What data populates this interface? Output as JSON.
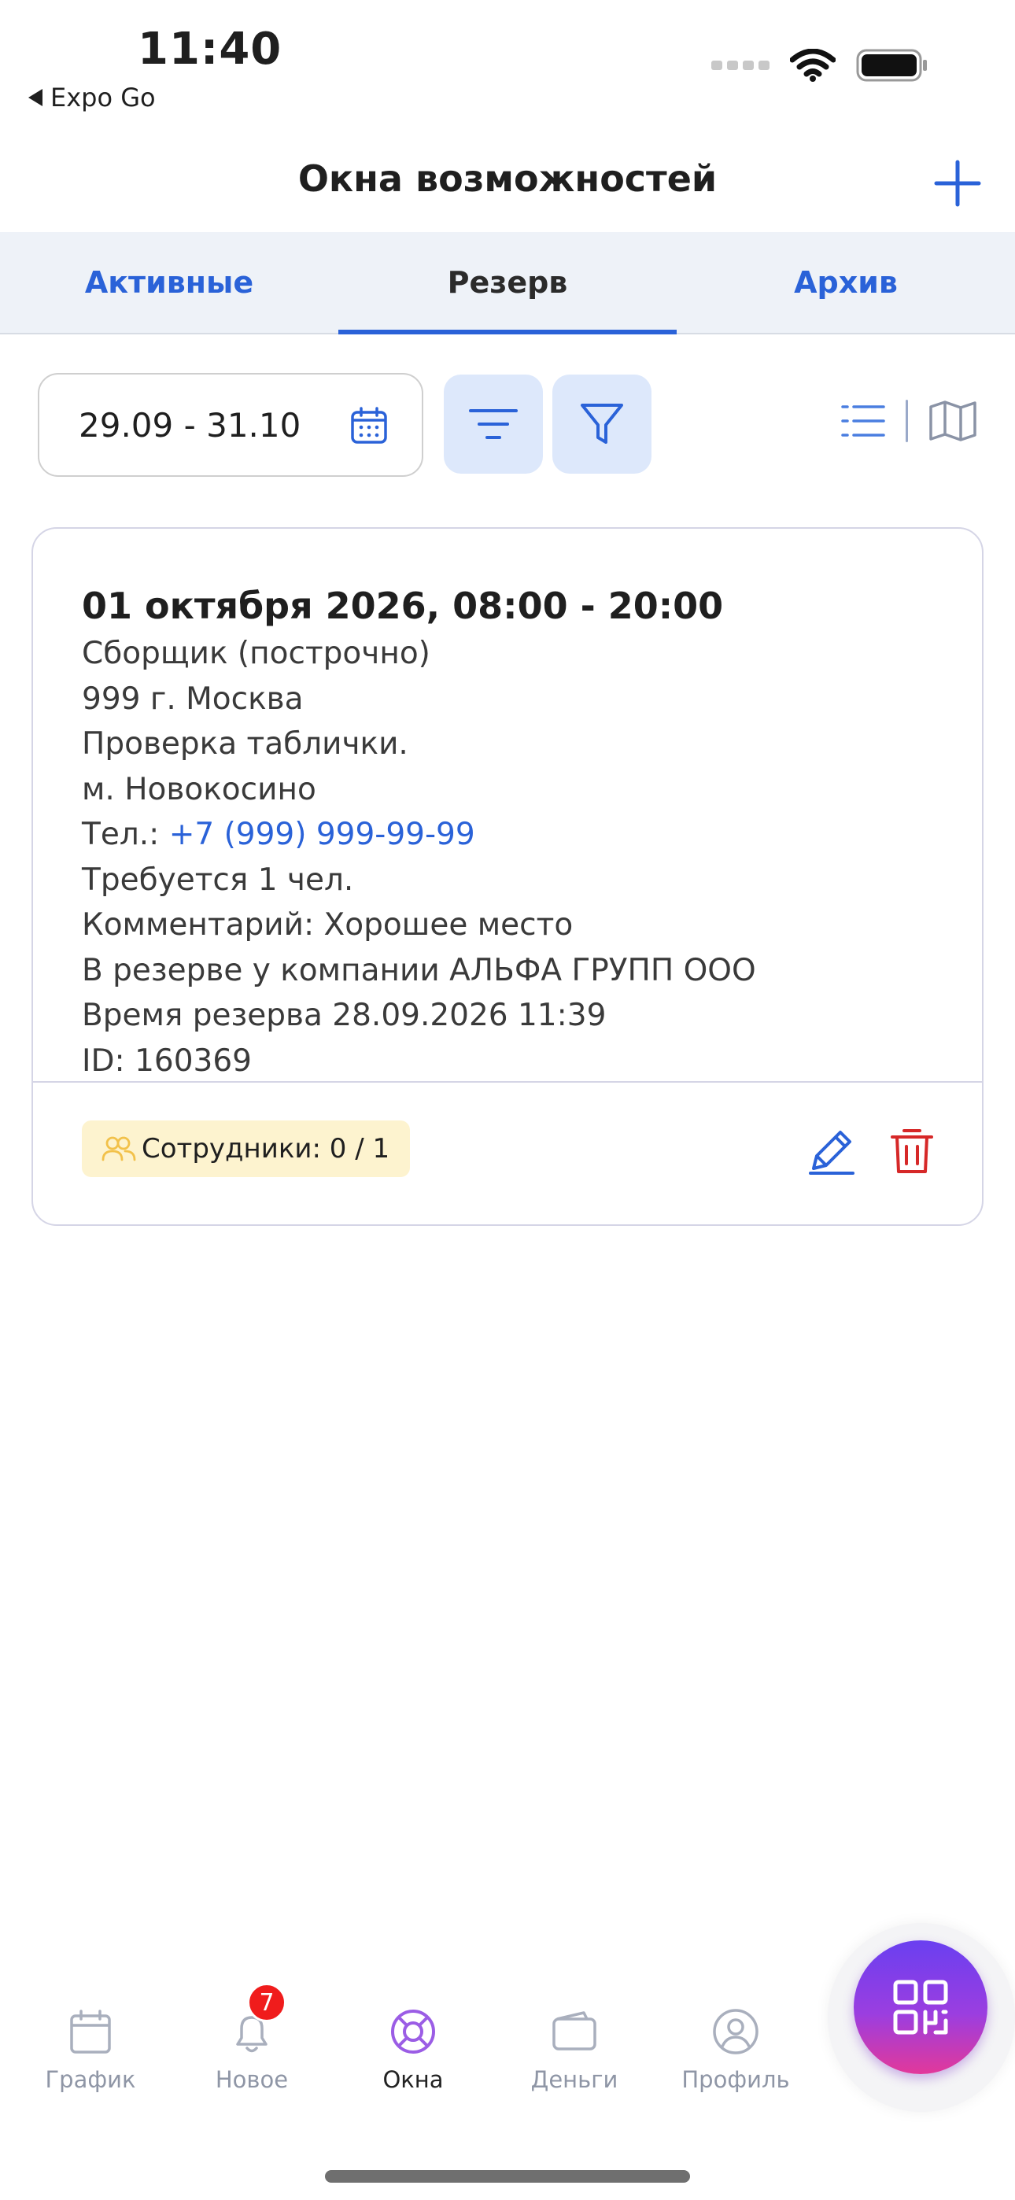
{
  "status_bar": {
    "time": "11:40",
    "back_app": "Expo Go"
  },
  "header": {
    "title": "Окна возможностей",
    "add_icon": "plus-icon"
  },
  "tabs": [
    {
      "label": "Активные",
      "active": false
    },
    {
      "label": "Резерв",
      "active": true
    },
    {
      "label": "Архив",
      "active": false
    }
  ],
  "toolbar": {
    "date_range": "29.09 - 31.10",
    "icons": [
      "calendar-icon",
      "sort-icon",
      "filter-icon",
      "list-view-icon",
      "map-view-icon"
    ]
  },
  "card": {
    "title": "01 октября 2026, 08:00 - 20:00",
    "position": "Сборщик (построчно)",
    "address": "999 г. Москва",
    "task": "Проверка таблички.",
    "metro": "м. Новокосино",
    "phone_label": "Тел.: ",
    "phone": "+7 (999) 999-99-99",
    "required": "Требуется 1 чел.",
    "comment": "Комментарий: Хорошее место",
    "reserved_by": "В резерве у компании АЛЬФА ГРУПП ООО",
    "reserve_time": "Время резерва 28.09.2026 11:39",
    "id": "ID: 160369",
    "employees": "Сотрудники: 0 / 1"
  },
  "bottom_nav": [
    {
      "label": "График",
      "icon": "calendar-icon",
      "active": false
    },
    {
      "label": "Новое",
      "icon": "bell-icon",
      "active": false,
      "badge": "7"
    },
    {
      "label": "Окна",
      "icon": "lifebuoy-icon",
      "active": true
    },
    {
      "label": "Деньги",
      "icon": "wallet-icon",
      "active": false
    },
    {
      "label": "Профиль",
      "icon": "user-icon",
      "active": false
    }
  ],
  "fab": {
    "icon": "qr-code-icon"
  },
  "colors": {
    "accent": "#2a62d8",
    "tab_bg": "#eef2f8",
    "tool_btn_bg": "#dde8fb",
    "badge_bg": "#fdf3cf",
    "delete": "#d62828",
    "nav_active": "#9b5de5",
    "fab_gradient": [
      "#6a3ff0",
      "#e2389a"
    ]
  }
}
